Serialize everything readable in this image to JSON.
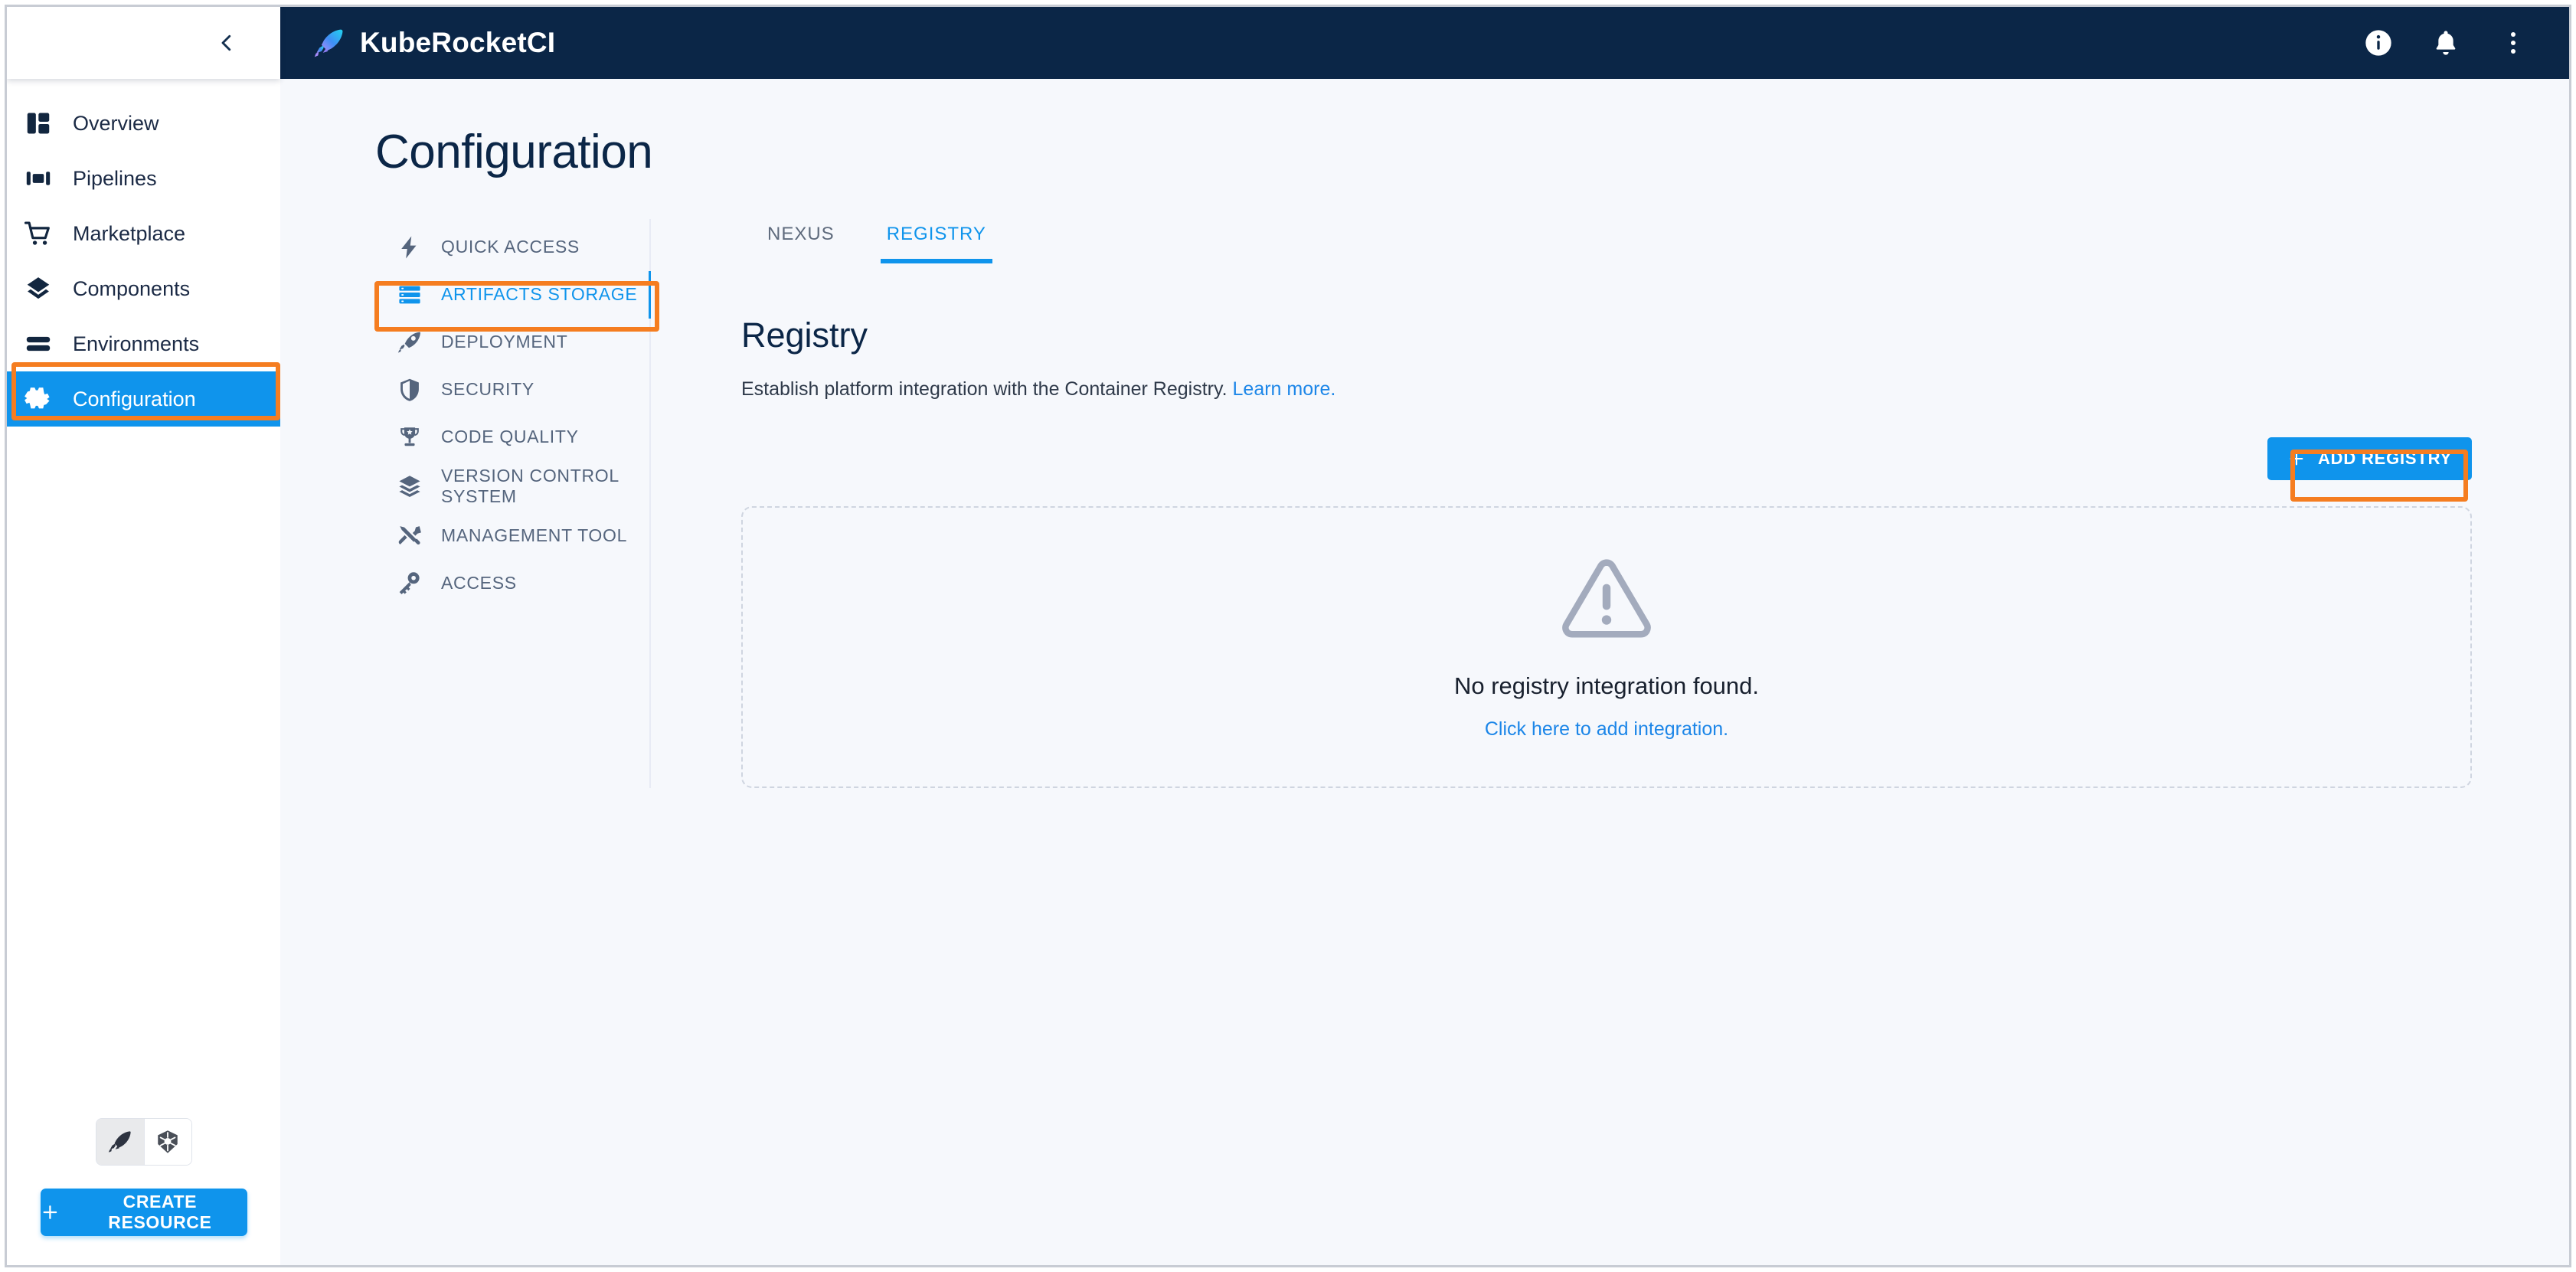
{
  "header": {
    "brand_name": "KubeRocketCI",
    "logo_icon": "rocket-logo-icon",
    "actions": [
      {
        "name": "info-icon",
        "label": "Info"
      },
      {
        "name": "bell-icon",
        "label": "Notifications"
      },
      {
        "name": "more-vertical-icon",
        "label": "More options"
      }
    ]
  },
  "sidebar": {
    "collapse_icon": "chevron-left-icon",
    "items": [
      {
        "label": "Overview",
        "icon": "dashboard-icon",
        "active": false
      },
      {
        "label": "Pipelines",
        "icon": "pipelines-icon",
        "active": false
      },
      {
        "label": "Marketplace",
        "icon": "cart-icon",
        "active": false
      },
      {
        "label": "Components",
        "icon": "layers-diamond-icon",
        "active": false
      },
      {
        "label": "Environments",
        "icon": "stack-bars-icon",
        "active": false
      },
      {
        "label": "Configuration",
        "icon": "gear-icon",
        "active": true
      }
    ],
    "mode_toggle": [
      {
        "name": "rocket-mode-icon",
        "selected": true
      },
      {
        "name": "kubernetes-mode-icon",
        "selected": false
      }
    ],
    "create_resource_label": "CREATE RESOURCE",
    "create_resource_icon": "plus-icon"
  },
  "main": {
    "page_title": "Configuration",
    "config_menu": [
      {
        "label": "QUICK ACCESS",
        "icon": "lightning-bolt-icon",
        "active": false
      },
      {
        "label": "ARTIFACTS STORAGE",
        "icon": "storage-rows-icon",
        "active": true
      },
      {
        "label": "DEPLOYMENT",
        "icon": "rocket-icon",
        "active": false
      },
      {
        "label": "SECURITY",
        "icon": "shield-icon",
        "active": false
      },
      {
        "label": "CODE QUALITY",
        "icon": "trophy-icon",
        "active": false
      },
      {
        "label": "VERSION CONTROL SYSTEM",
        "icon": "layers-icon",
        "active": false
      },
      {
        "label": "MANAGEMENT TOOL",
        "icon": "tools-icon",
        "active": false
      },
      {
        "label": "ACCESS",
        "icon": "key-icon",
        "active": false
      }
    ],
    "tabs": [
      {
        "label": "NEXUS",
        "active": false
      },
      {
        "label": "REGISTRY",
        "active": true
      }
    ],
    "section_title": "Registry",
    "section_desc": "Establish platform integration with the Container Registry.",
    "section_desc_link": "Learn more.",
    "add_button_label": "ADD REGISTRY",
    "add_button_icon": "plus-icon",
    "empty_state": {
      "icon": "warning-triangle-icon",
      "title": "No registry integration found.",
      "link": "Click here to add integration."
    }
  },
  "colors": {
    "accent_blue": "#0f94ec",
    "highlight_orange": "#f57d20",
    "topbar_navy": "#0b2647",
    "page_bg": "#f6f8fc",
    "muted_text": "#55657d"
  }
}
